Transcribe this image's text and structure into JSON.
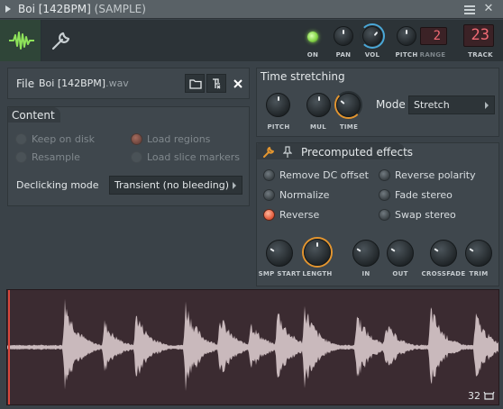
{
  "window": {
    "title": "Boi [142BPM]",
    "title_suffix": "(SAMPLE)"
  },
  "toolbar": {
    "on_label": "ON",
    "pan_label": "PAN",
    "vol_label": "VOL",
    "pitch_label": "PITCH",
    "range_label": "RANGE",
    "range_value": "2",
    "track_label": "TRACK",
    "track_value": "23"
  },
  "file": {
    "label": "File",
    "name": "Boi [142BPM]",
    "ext": ".wav"
  },
  "content": {
    "title": "Content",
    "options": [
      {
        "label": "Keep on disk",
        "selected": false
      },
      {
        "label": "Load regions",
        "selected": true
      },
      {
        "label": "Resample",
        "selected": false
      },
      {
        "label": "Load slice markers",
        "selected": false
      }
    ],
    "declicking_label": "Declicking mode",
    "declicking_value": "Transient (no bleeding)"
  },
  "time_stretching": {
    "title": "Time stretching",
    "pitch_label": "PITCH",
    "mul_label": "MUL",
    "time_label": "TIME",
    "mode_label": "Mode",
    "mode_value": "Stretch"
  },
  "precomputed": {
    "title": "Precomputed effects",
    "effects": [
      {
        "label": "Remove DC offset",
        "selected": false
      },
      {
        "label": "Reverse polarity",
        "selected": false
      },
      {
        "label": "Normalize",
        "selected": false
      },
      {
        "label": "Fade stereo",
        "selected": false
      },
      {
        "label": "Reverse",
        "selected": true
      },
      {
        "label": "Swap stereo",
        "selected": false
      }
    ],
    "knobs": [
      "SMP START",
      "LENGTH",
      "IN",
      "OUT",
      "CROSSFADE",
      "TRIM"
    ]
  },
  "waveform": {
    "zoom_value": "32"
  },
  "colors": {
    "accent_green": "#86d64a",
    "accent_blue": "#4aa8d8",
    "accent_orange": "#e3952f",
    "lcd_red": "#f06a74",
    "wave_fill": "#c9b9bc",
    "wave_bg": "#3b2b31"
  },
  "icons": [
    "waveform-icon",
    "wrench-icon",
    "folder-icon",
    "file-locate-icon",
    "close-icon",
    "loop-icon",
    "menu-icon"
  ]
}
